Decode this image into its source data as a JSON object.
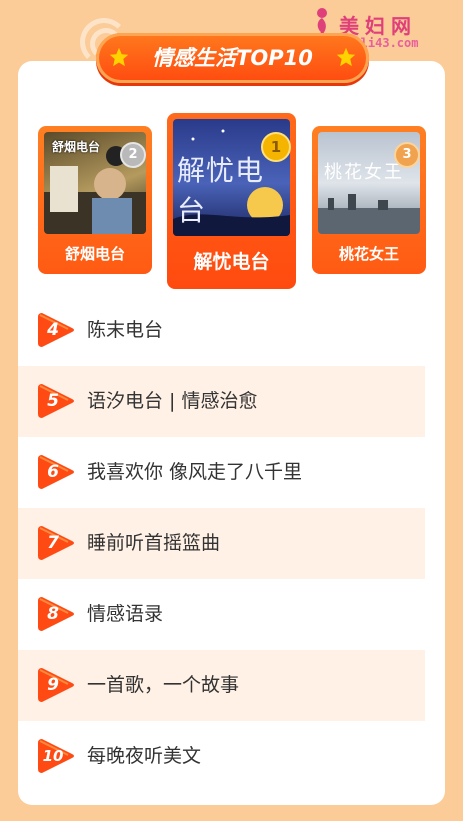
{
  "watermark": {
    "cn": "美妇网",
    "url": "meili43.com"
  },
  "header": {
    "title": "情感生活TOP10"
  },
  "top3": [
    {
      "rank": "2",
      "label": "舒烟电台",
      "cover_text": "舒烟电台",
      "position": "left"
    },
    {
      "rank": "1",
      "label": "解忧电台",
      "cover_text": "解忧电台",
      "position": "center"
    },
    {
      "rank": "3",
      "label": "桃花女王",
      "cover_text": "桃花女王",
      "position": "right"
    }
  ],
  "list": [
    {
      "rank": "4",
      "label": "陈末电台"
    },
    {
      "rank": "5",
      "label": "语汐电台 | 情感治愈"
    },
    {
      "rank": "6",
      "label": "我喜欢你 像风走了八千里"
    },
    {
      "rank": "7",
      "label": "睡前听首摇篮曲"
    },
    {
      "rank": "8",
      "label": "情感语录"
    },
    {
      "rank": "9",
      "label": "一首歌，一个故事"
    },
    {
      "rank": "10",
      "label": "每晚夜听美文"
    }
  ],
  "colors": {
    "accent": "#ff5a13",
    "background": "#fbcb98",
    "row_shade": "#fff1e6",
    "gold": "#f4b400",
    "silver": "#b9b9b9",
    "bronze": "#f0a24e"
  },
  "icons": {
    "star": "star-icon",
    "rank_badge": "play-shape-badge",
    "medal": "medal-icon"
  }
}
